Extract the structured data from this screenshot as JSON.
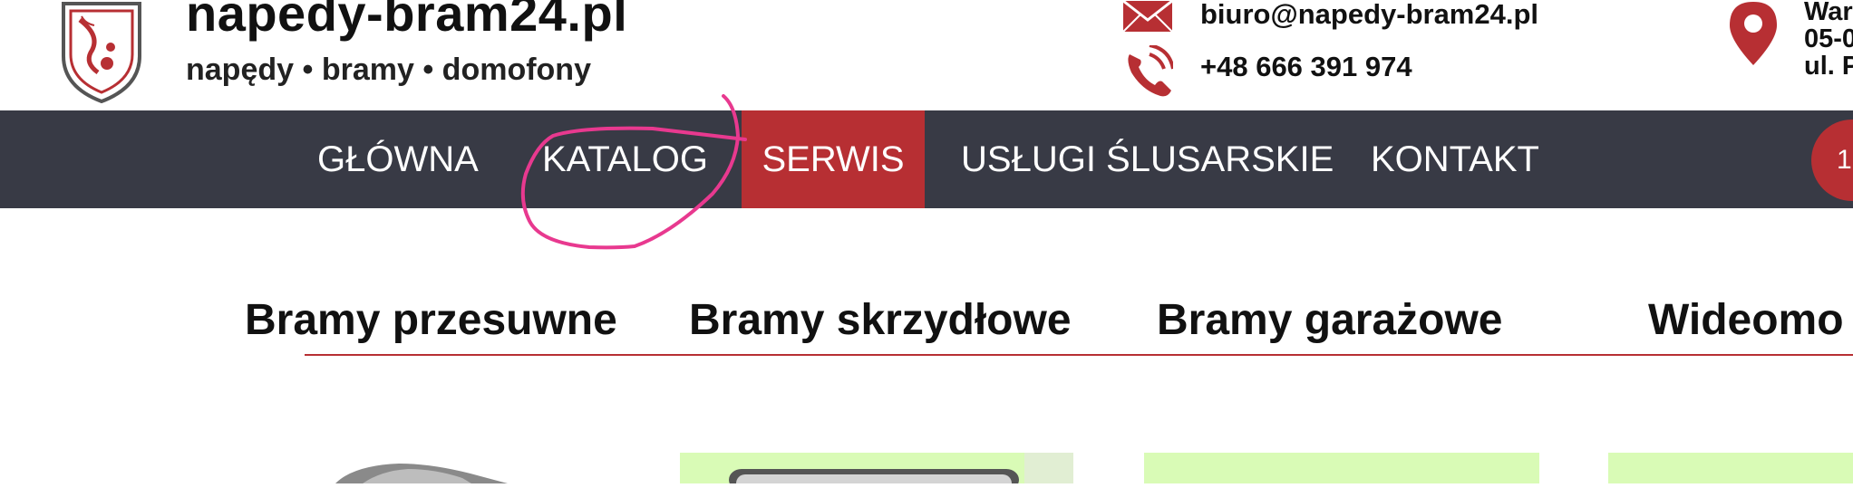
{
  "header": {
    "title": "napedy-bram24.pl",
    "subtitle": "napędy • bramy • domofony",
    "email": "biuro@napedy-bram24.pl",
    "phone": "+48 666 391 974",
    "address_lines": [
      "War",
      "05-0",
      "ul. P"
    ]
  },
  "nav": {
    "items": [
      {
        "label": "GŁÓWNA"
      },
      {
        "label": "KATALOG"
      },
      {
        "label": "SERWIS",
        "active": true
      },
      {
        "label": "USŁUGI ŚLUSARSKIE"
      },
      {
        "label": "KONTAKT"
      }
    ],
    "cart_count": "1"
  },
  "categories": [
    {
      "label": "Bramy przesuwne"
    },
    {
      "label": "Bramy skrzydłowe"
    },
    {
      "label": "Bramy garażowe"
    },
    {
      "label": "Wideomo"
    }
  ],
  "colors": {
    "accent": "#b72f33",
    "nav_bg": "#383a45",
    "annotation": "#e8398f",
    "product_bg": "#d9fbb6"
  },
  "icons": {
    "logo": "shield-logo-icon",
    "email": "envelope-icon",
    "phone": "phone-icon",
    "address": "map-pin-icon"
  }
}
